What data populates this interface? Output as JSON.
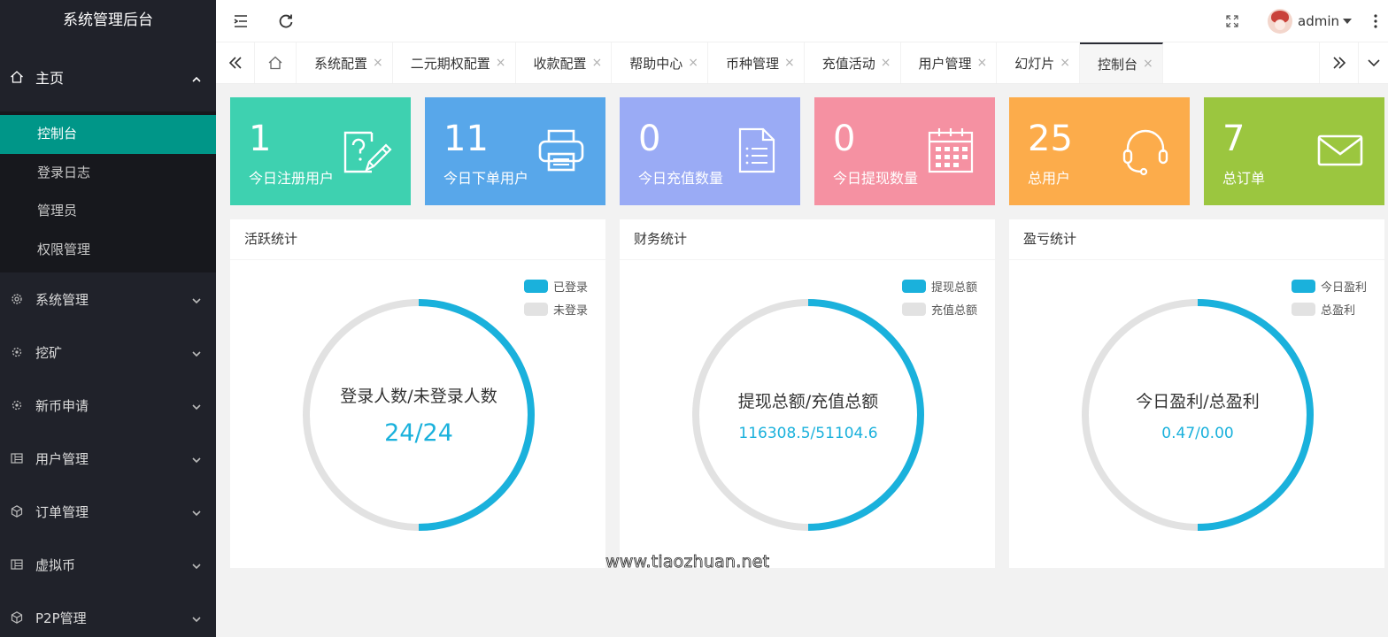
{
  "sidebar": {
    "brand": "系统管理后台",
    "home": {
      "label": "主页",
      "icon": "home-icon"
    },
    "home_items": [
      {
        "label": "控制台",
        "active": true
      },
      {
        "label": "登录日志",
        "active": false
      },
      {
        "label": "管理员",
        "active": false
      },
      {
        "label": "权限管理",
        "active": false
      }
    ],
    "groups": [
      {
        "label": "系统管理",
        "icon": "gear-icon"
      },
      {
        "label": "挖矿",
        "icon": "cog-icon"
      },
      {
        "label": "新币申请",
        "icon": "cog-icon"
      },
      {
        "label": "用户管理",
        "icon": "table-icon"
      },
      {
        "label": "订单管理",
        "icon": "box-icon"
      },
      {
        "label": "虚拟币",
        "icon": "table-icon"
      },
      {
        "label": "P2P管理",
        "icon": "box-icon"
      }
    ]
  },
  "header": {
    "user_name": "admin"
  },
  "tabs": {
    "items": [
      {
        "label": "系统配置",
        "active": false
      },
      {
        "label": "二元期权配置",
        "active": false
      },
      {
        "label": "收款配置",
        "active": false
      },
      {
        "label": "帮助中心",
        "active": false
      },
      {
        "label": "币种管理",
        "active": false
      },
      {
        "label": "充值活动",
        "active": false
      },
      {
        "label": "用户管理",
        "active": false
      },
      {
        "label": "幻灯片",
        "active": false
      },
      {
        "label": "控制台",
        "active": true
      }
    ],
    "close_glyph": "×"
  },
  "stats": [
    {
      "value": "1",
      "label": "今日注册用户",
      "color": "#3ed1b0",
      "icon": "question-edit-icon"
    },
    {
      "value": "11",
      "label": "今日下单用户",
      "color": "#58a7ea",
      "icon": "printer-icon"
    },
    {
      "value": "0",
      "label": "今日充值数量",
      "color": "#9aabf5",
      "icon": "document-list-icon"
    },
    {
      "value": "0",
      "label": "今日提现数量",
      "color": "#f591a2",
      "icon": "calendar-icon"
    },
    {
      "value": "25",
      "label": "总用户",
      "color": "#fcac4b",
      "icon": "headset-icon"
    },
    {
      "value": "7",
      "label": "总订单",
      "color": "#9bc63f",
      "icon": "mail-icon"
    }
  ],
  "panels": [
    {
      "title": "活跃统计",
      "legend": [
        "已登录",
        "未登录"
      ],
      "center_label": "登录人数/未登录人数",
      "center_value": "24/24",
      "big_value": true
    },
    {
      "title": "财务统计",
      "legend": [
        "提现总额",
        "充值总额"
      ],
      "center_label": "提现总额/充值总额",
      "center_value": "116308.5/51104.6",
      "big_value": false
    },
    {
      "title": "盈亏统计",
      "legend": [
        "今日盈利",
        "总盈利"
      ],
      "center_label": "今日盈利/总盈利",
      "center_value": "0.47/0.00",
      "big_value": false
    }
  ],
  "colors": {
    "accent": "#1ab1dc",
    "track": "#e2e2e2",
    "active_menu": "#009688",
    "sidebar_bg": "#20222a"
  },
  "watermark": "www.tiaozhuan.net"
}
